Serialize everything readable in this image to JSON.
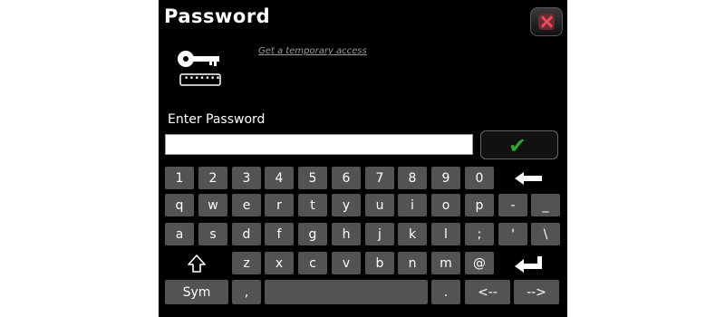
{
  "title": "Password",
  "temporary_access_link": "Get a temporary access",
  "enter_password_label": "Enter Password",
  "password_value": "",
  "key_icon_masked": "•••••••",
  "keyboard": {
    "row1": [
      "1",
      "2",
      "3",
      "4",
      "5",
      "6",
      "7",
      "8",
      "9",
      "0"
    ],
    "row2": [
      "q",
      "w",
      "e",
      "r",
      "t",
      "y",
      "u",
      "i",
      "o",
      "p",
      "-",
      "_"
    ],
    "row3": [
      "a",
      "s",
      "d",
      "f",
      "g",
      "h",
      "j",
      "k",
      "l",
      ";",
      "'",
      "\\"
    ],
    "row4": [
      "z",
      "x",
      "c",
      "v",
      "b",
      "n",
      "m",
      "@"
    ],
    "sym": "Sym",
    "comma": ",",
    "period": ".",
    "cursor_left": "<--",
    "cursor_right": "-->"
  },
  "icons": {
    "close": "close-icon",
    "confirm": "checkmark-icon",
    "backspace": "backspace-arrow-icon",
    "shift": "shift-arrow-icon",
    "enter": "enter-icon",
    "key": "key-icon"
  },
  "colors": {
    "panel_bg": "#000000",
    "key_bg": "#535353",
    "confirm_check": "#2ea12e",
    "close_red": "#e94a5a"
  }
}
